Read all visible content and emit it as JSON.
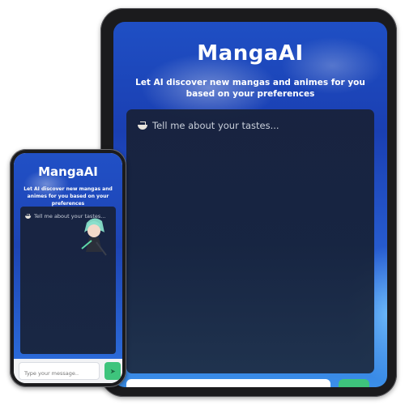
{
  "tablet": {
    "title": "MangaAI",
    "subtitle": "Let AI discover new mangas and animes for you based on your preferences",
    "chat_hint": "Tell me about your tastes...",
    "hint_icon": "ramen-bowl-icon"
  },
  "phone": {
    "title": "MangaAI",
    "subtitle": "Let AI discover new mangas and animes for you based on your preferences",
    "chat_hint": "Tell me about your tastes...",
    "hint_icon": "ramen-bowl-icon",
    "input_placeholder": "Type your message..",
    "send_icon": "send-icon"
  },
  "colors": {
    "accent_send": "#3ec47c",
    "chat_panel": "#18223c",
    "background_blue": "#1f4fc4"
  }
}
